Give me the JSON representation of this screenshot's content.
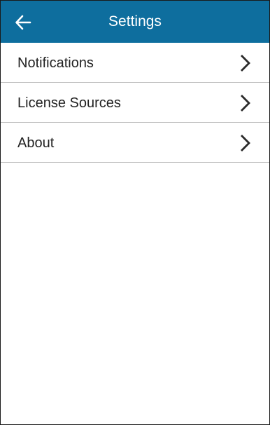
{
  "colors": {
    "app_bar": "#0e6e9e",
    "icon": "#ffffff",
    "text": "#222222",
    "divider": "#bdbdbd",
    "chevron": "#2a2a2a"
  },
  "header": {
    "title": "Settings",
    "back_icon": "arrow-left-icon"
  },
  "settings": {
    "items": [
      {
        "label": "Notifications",
        "icon": "chevron-right-icon"
      },
      {
        "label": "License Sources",
        "icon": "chevron-right-icon"
      },
      {
        "label": "About",
        "icon": "chevron-right-icon"
      }
    ]
  }
}
